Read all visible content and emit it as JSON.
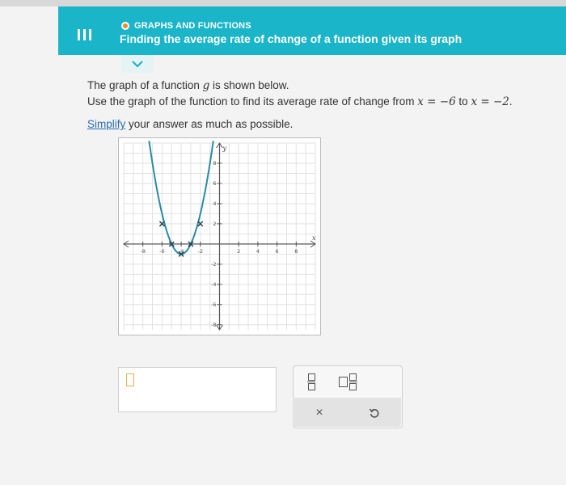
{
  "header": {
    "topic": "GRAPHS AND FUNCTIONS",
    "lesson_title": "Finding the average rate of change of a function given its graph",
    "colors": {
      "bar": "#1ab5c9",
      "topic_dot": "#f08a1c"
    }
  },
  "nav": {
    "menu_icon": "hamburger-icon",
    "expand_icon": "chevron-down-icon"
  },
  "question": {
    "line1_pre": "The graph of a function ",
    "line1_var": "g",
    "line1_post": " is shown below.",
    "line2_pre": "Use the graph of the function to find its average rate of change from ",
    "x1": "x = −6",
    "to": " to ",
    "x2": "x = −2",
    "end": ".",
    "simplify_link": "Simplify",
    "simplify_rest": " your answer as much as possible."
  },
  "graph": {
    "x_label": "x",
    "y_label": "y",
    "x_ticks": [
      "-8",
      "-6",
      "-4",
      "-2",
      "2",
      "4",
      "6",
      "8"
    ],
    "y_ticks": [
      "8",
      "6",
      "4",
      "2",
      "-2",
      "-4",
      "-6",
      "-8"
    ],
    "xlim": [
      -10,
      10
    ],
    "ylim": [
      -8.5,
      10
    ],
    "curve_color": "#2a8ba3",
    "points": [
      {
        "x": -6,
        "y": 2
      },
      {
        "x": -5,
        "y": 0
      },
      {
        "x": -4,
        "y": -1
      },
      {
        "x": -3,
        "y": 0
      },
      {
        "x": -2,
        "y": 2
      }
    ]
  },
  "answer": {
    "value": ""
  },
  "palette": {
    "fraction_icon": "fraction-icon",
    "mixed_number_icon": "mixed-number-icon",
    "clear_label": "×",
    "undo_icon": "undo-icon"
  }
}
